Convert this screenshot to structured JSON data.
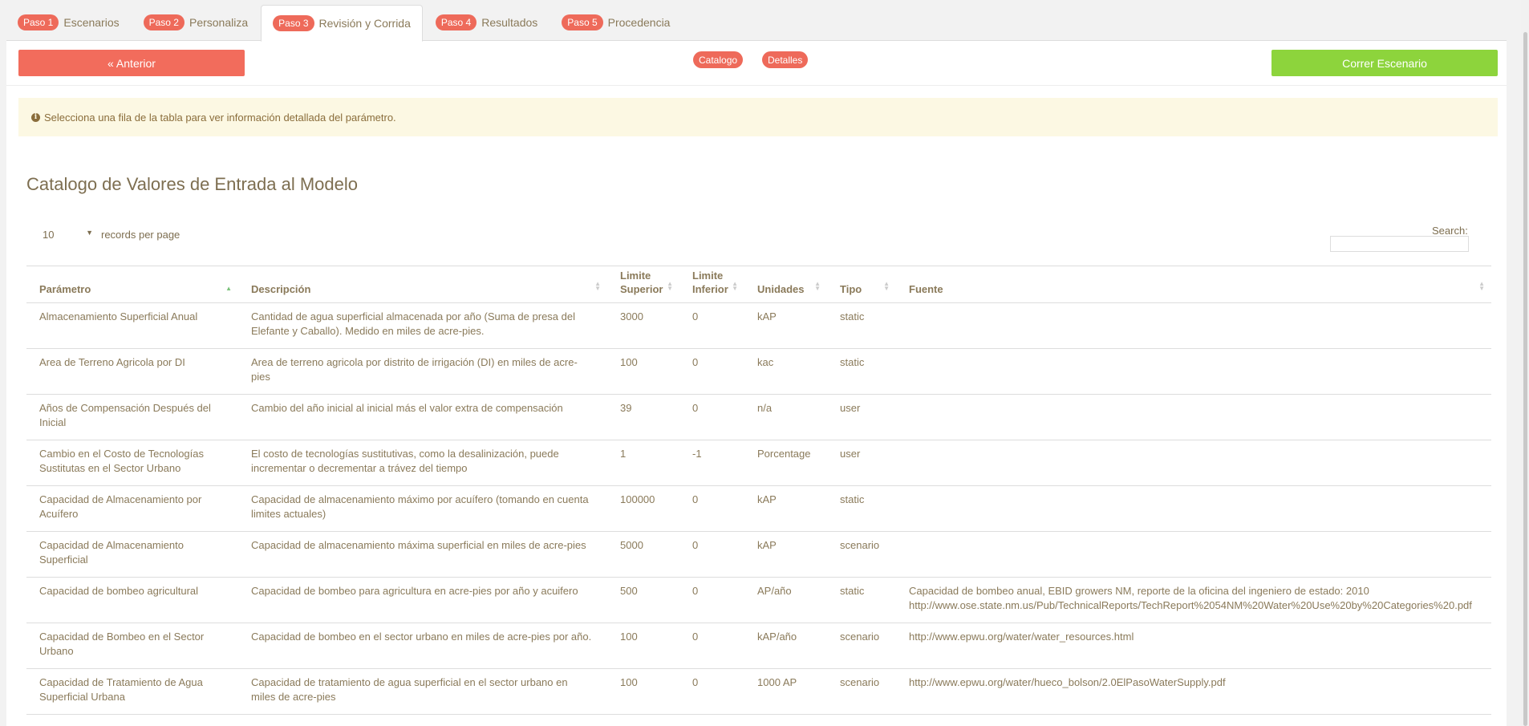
{
  "tabs": [
    {
      "badge": "Paso 1",
      "label": "Escenarios"
    },
    {
      "badge": "Paso 2",
      "label": "Personaliza"
    },
    {
      "badge": "Paso 3",
      "label": "Revisión y Corrida"
    },
    {
      "badge": "Paso 4",
      "label": "Resultados"
    },
    {
      "badge": "Paso 5",
      "label": "Procedencia"
    }
  ],
  "toolbar": {
    "prev_label": "« Anterior",
    "catalog_label": "Catalogo",
    "details_label": "Detalles",
    "run_label": "Correr Escenario"
  },
  "alert": {
    "icon": "info-circle-icon",
    "text": "Selecciona una fila de la tabla para ver información detallada del parámetro."
  },
  "page_title": "Catalogo de Valores de Entrada al Modelo",
  "length_menu": {
    "value": "10",
    "label": "records per page"
  },
  "search": {
    "label": "Search:",
    "value": ""
  },
  "table": {
    "headers": [
      "Parámetro",
      "Descripción",
      "Limite Superior",
      "Limite Inferior",
      "Unidades",
      "Tipo",
      "Fuente"
    ],
    "rows": [
      [
        "Almacenamiento Superficial Anual",
        "Cantidad de agua superficial almacenada por año (Suma de presa del Elefante y Caballo). Medido en miles de acre-pies.",
        "3000",
        "0",
        "kAP",
        "static",
        ""
      ],
      [
        "Area de Terreno Agricola por DI",
        "Area de terreno agricola por distrito de irrigación (DI) en miles de acre-pies",
        "100",
        "0",
        "kac",
        "static",
        ""
      ],
      [
        "Años de Compensación Después del Inicial",
        "Cambio del año inicial al inicial más el valor extra de compensación",
        "39",
        "0",
        "n/a",
        "user",
        ""
      ],
      [
        "Cambio en el Costo de Tecnologías Sustitutas en el Sector Urbano",
        "El costo de tecnologías sustitutivas, como la desalinización, puede incrementar o decrementar a trávez del tiempo",
        "1",
        "-1",
        "Porcentage",
        "user",
        ""
      ],
      [
        "Capacidad de Almacenamiento por Acuífero",
        "Capacidad de almacenamiento máximo por acuífero (tomando en cuenta limites actuales)",
        "100000",
        "0",
        "kAP",
        "static",
        ""
      ],
      [
        "Capacidad de Almacenamiento Superficial",
        "Capacidad de almacenamiento máxima superficial en miles de acre-pies",
        "5000",
        "0",
        "kAP",
        "scenario",
        ""
      ],
      [
        "Capacidad de bombeo agricultural",
        "Capacidad de bombeo para agricultura en acre-pies por año y acuifero",
        "500",
        "0",
        "AP/año",
        "static",
        "Capacidad de bombeo anual, EBID growers NM, reporte de la oficina del ingeniero de estado: 2010 http://www.ose.state.nm.us/Pub/TechnicalReports/TechReport%2054NM%20Water%20Use%20by%20Categories%20.pdf"
      ],
      [
        "Capacidad de Bombeo en el Sector Urbano",
        "Capacidad de bombeo en el sector urbano en miles de acre-pies por año.",
        "100",
        "0",
        "kAP/año",
        "scenario",
        "http://www.epwu.org/water/water_resources.html"
      ],
      [
        "Capacidad de Tratamiento de Agua Superficial Urbana",
        "Capacidad de tratamiento de agua superficial en el sector urbano en miles de acre-pies",
        "100",
        "0",
        "1000 AP",
        "scenario",
        "http://www.epwu.org/water/hueco_bolson/2.0ElPasoWaterSupply.pdf"
      ]
    ]
  },
  "colors": {
    "badge": "#ee6a5a",
    "prev_button": "#f26c5c",
    "run_button": "#8dd43c",
    "alert_bg": "#fcf8e3"
  }
}
